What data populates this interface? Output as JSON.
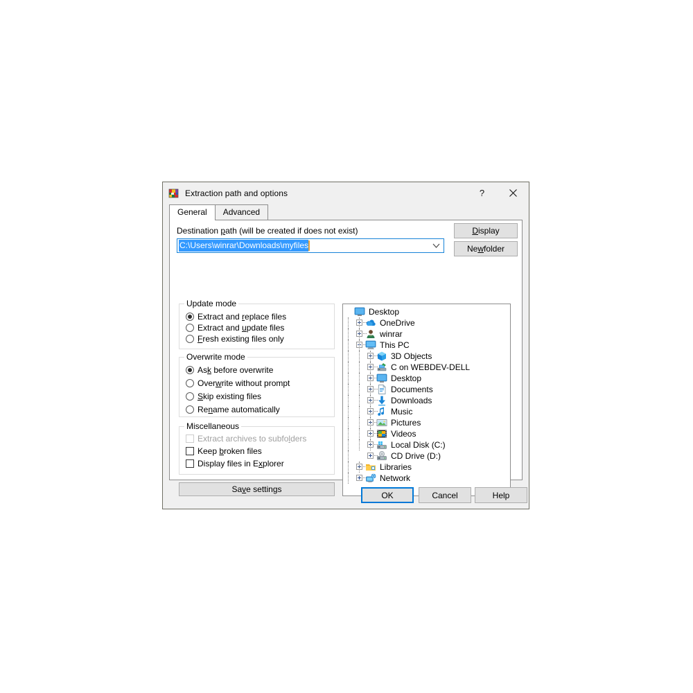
{
  "window": {
    "title": "Extraction path and options",
    "icon": "winrar-books-icon",
    "help_btn": "?",
    "close_btn": "✕"
  },
  "tabs": [
    {
      "label": "General",
      "active": true
    },
    {
      "label": "Advanced",
      "active": false
    }
  ],
  "destination": {
    "label_pre": "Destination ",
    "label_accel": "p",
    "label_post": "ath (will be created if does not exist)",
    "label_full": "Destination path (will be created if does not exist)",
    "value": "C:\\Users\\winrar\\Downloads\\myfiles",
    "selected": true,
    "selection_color": "#3399ff",
    "caret_color": "#e8a33d",
    "dropdown_icon": "chevron-down-icon"
  },
  "side_buttons": [
    {
      "name": "display-button",
      "pre": "",
      "accel": "D",
      "post": "isplay",
      "full": "Display"
    },
    {
      "name": "new-folder-button",
      "pre": "Ne",
      "accel": "w",
      "post": " folder",
      "full": "New folder"
    }
  ],
  "update_mode": {
    "title": "Update mode",
    "options": [
      {
        "pre": "Extract and ",
        "accel": "r",
        "post": "eplace files",
        "full": "Extract and replace files",
        "selected": true
      },
      {
        "pre": "Extract and ",
        "accel": "u",
        "post": "pdate files",
        "full": "Extract and update files",
        "selected": false
      },
      {
        "pre": "",
        "accel": "F",
        "post": "resh existing files only",
        "full": "Fresh existing files only",
        "selected": false
      }
    ]
  },
  "overwrite_mode": {
    "title": "Overwrite mode",
    "options": [
      {
        "pre": "As",
        "accel": "k",
        "post": " before overwrite",
        "full": "Ask before overwrite",
        "selected": true
      },
      {
        "pre": "Over",
        "accel": "w",
        "post": "rite without prompt",
        "full": "Overwrite without prompt",
        "selected": false
      },
      {
        "pre": "",
        "accel": "S",
        "post": "kip existing files",
        "full": "Skip existing files",
        "selected": false
      },
      {
        "pre": "Re",
        "accel": "n",
        "post": "ame automatically",
        "full": "Rename automatically",
        "selected": false
      }
    ]
  },
  "miscellaneous": {
    "title": "Miscellaneous",
    "options": [
      {
        "pre": "Extract archives to subfo",
        "accel": "l",
        "post": "ders",
        "full": "Extract archives to subfolders",
        "checked": false,
        "disabled": true
      },
      {
        "pre": "Keep ",
        "accel": "b",
        "post": "roken files",
        "full": "Keep broken files",
        "checked": false,
        "disabled": false
      },
      {
        "pre": "Display files in E",
        "accel": "x",
        "post": "plorer",
        "full": "Display files in Explorer",
        "checked": false,
        "disabled": false
      }
    ]
  },
  "save_settings": {
    "pre": "Sa",
    "accel": "v",
    "post": "e settings",
    "full": "Save settings"
  },
  "tree": [
    {
      "label": "Desktop",
      "depth": 0,
      "icon": "desktop-monitor-icon",
      "toggle": "none",
      "guides": []
    },
    {
      "label": "OneDrive",
      "depth": 1,
      "icon": "onedrive-cloud-icon",
      "toggle": "plus",
      "guides": []
    },
    {
      "label": "winrar",
      "depth": 1,
      "icon": "user-person-icon",
      "toggle": "plus",
      "guides": []
    },
    {
      "label": "This PC",
      "depth": 1,
      "icon": "this-pc-icon",
      "toggle": "minus",
      "guides": []
    },
    {
      "label": "3D Objects",
      "depth": 2,
      "icon": "3d-objects-cube-icon",
      "toggle": "plus",
      "guides": [
        1
      ]
    },
    {
      "label": "C on WEBDEV-DELL",
      "depth": 2,
      "icon": "network-drive-icon",
      "toggle": "plus",
      "guides": [
        1
      ]
    },
    {
      "label": "Desktop",
      "depth": 2,
      "icon": "desktop-monitor-icon",
      "toggle": "plus",
      "guides": [
        1
      ]
    },
    {
      "label": "Documents",
      "depth": 2,
      "icon": "documents-page-icon",
      "toggle": "plus",
      "guides": [
        1
      ]
    },
    {
      "label": "Downloads",
      "depth": 2,
      "icon": "downloads-arrow-icon",
      "toggle": "plus",
      "guides": [
        1
      ]
    },
    {
      "label": "Music",
      "depth": 2,
      "icon": "music-note-icon",
      "toggle": "plus",
      "guides": [
        1
      ]
    },
    {
      "label": "Pictures",
      "depth": 2,
      "icon": "pictures-image-icon",
      "toggle": "plus",
      "guides": [
        1
      ]
    },
    {
      "label": "Videos",
      "depth": 2,
      "icon": "videos-film-icon",
      "toggle": "plus",
      "guides": [
        1
      ]
    },
    {
      "label": "Local Disk (C:)",
      "depth": 2,
      "icon": "hard-drive-icon",
      "toggle": "plus",
      "guides": [
        1
      ]
    },
    {
      "label": "CD Drive (D:)",
      "depth": 2,
      "icon": "cd-drive-icon",
      "toggle": "plus",
      "guides": [
        1
      ]
    },
    {
      "label": "Libraries",
      "depth": 1,
      "icon": "libraries-folder-icon",
      "toggle": "plus",
      "guides": []
    },
    {
      "label": "Network",
      "depth": 1,
      "icon": "network-globe-icon",
      "toggle": "plus",
      "guides": []
    }
  ],
  "bottom_buttons": [
    {
      "name": "ok-button",
      "label": "OK",
      "default": true
    },
    {
      "name": "cancel-button",
      "label": "Cancel",
      "default": false
    },
    {
      "name": "help-button",
      "label": "Help",
      "default": false
    }
  ]
}
